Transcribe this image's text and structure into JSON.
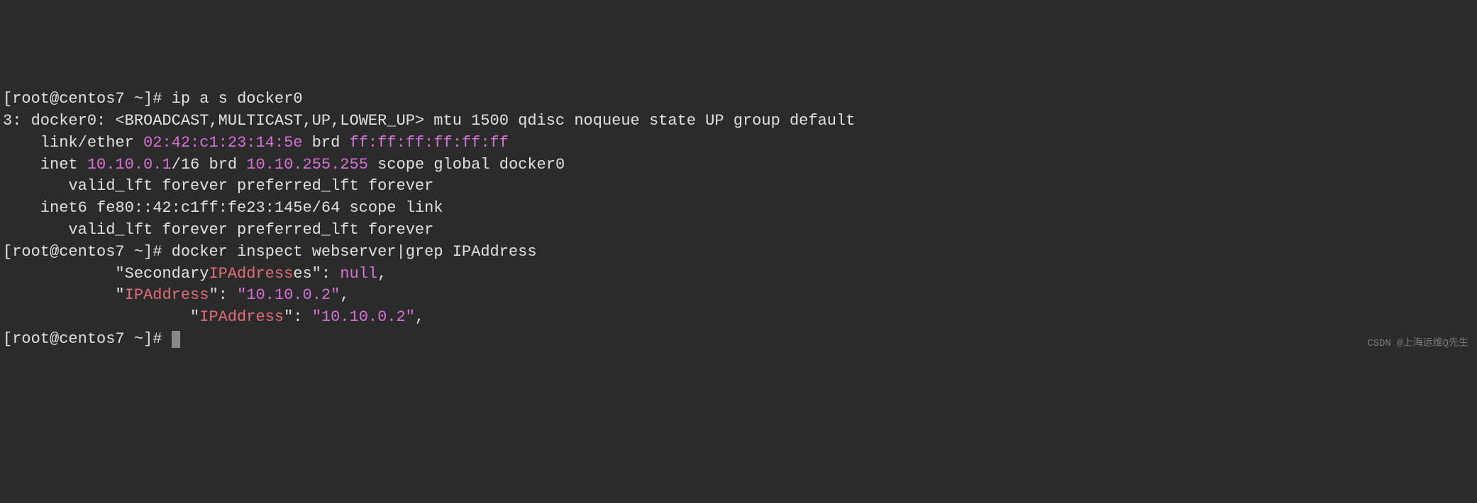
{
  "prompt": {
    "open": "[",
    "user": "root",
    "at": "@",
    "host": "centos7",
    "space": " ",
    "path": "~",
    "close": "]",
    "hash": "# "
  },
  "cmd1": "ip a s docker0",
  "out1": {
    "line1a": "3: docker0: <BROADCAST,MULTICAST,UP,LOWER_UP> mtu 1500 qdisc noqueue state UP group default",
    "line2a": "    link/ether ",
    "line2b": "02:42:c1:23:14:5e",
    "line2c": " brd ",
    "line2d": "ff:ff:ff:ff:ff:ff",
    "line3a": "    inet ",
    "line3b": "10.10.0.1",
    "line3c": "/16 brd ",
    "line3d": "10.10.255.255",
    "line3e": " scope global docker0",
    "line4": "       valid_lft forever preferred_lft forever",
    "line5": "    inet6 fe80::42:c1ff:fe23:145e/64 scope link",
    "line6": "       valid_lft forever preferred_lft forever"
  },
  "cmd2": "docker inspect webserver|grep IPAddress",
  "out2": {
    "line1a": "            \"Secondary",
    "line1b": "IPAddress",
    "line1c": "es\": ",
    "line1d": "null",
    "line1e": ",",
    "line2a": "            \"",
    "line2b": "IPAddress",
    "line2c": "\": ",
    "line2d": "\"10.10.0.2\"",
    "line2e": ",",
    "line3a": "                    \"",
    "line3b": "IPAddress",
    "line3c": "\": ",
    "line3d": "\"10.10.0.2\"",
    "line3e": ","
  },
  "watermark": "CSDN @上海运维Q先生"
}
